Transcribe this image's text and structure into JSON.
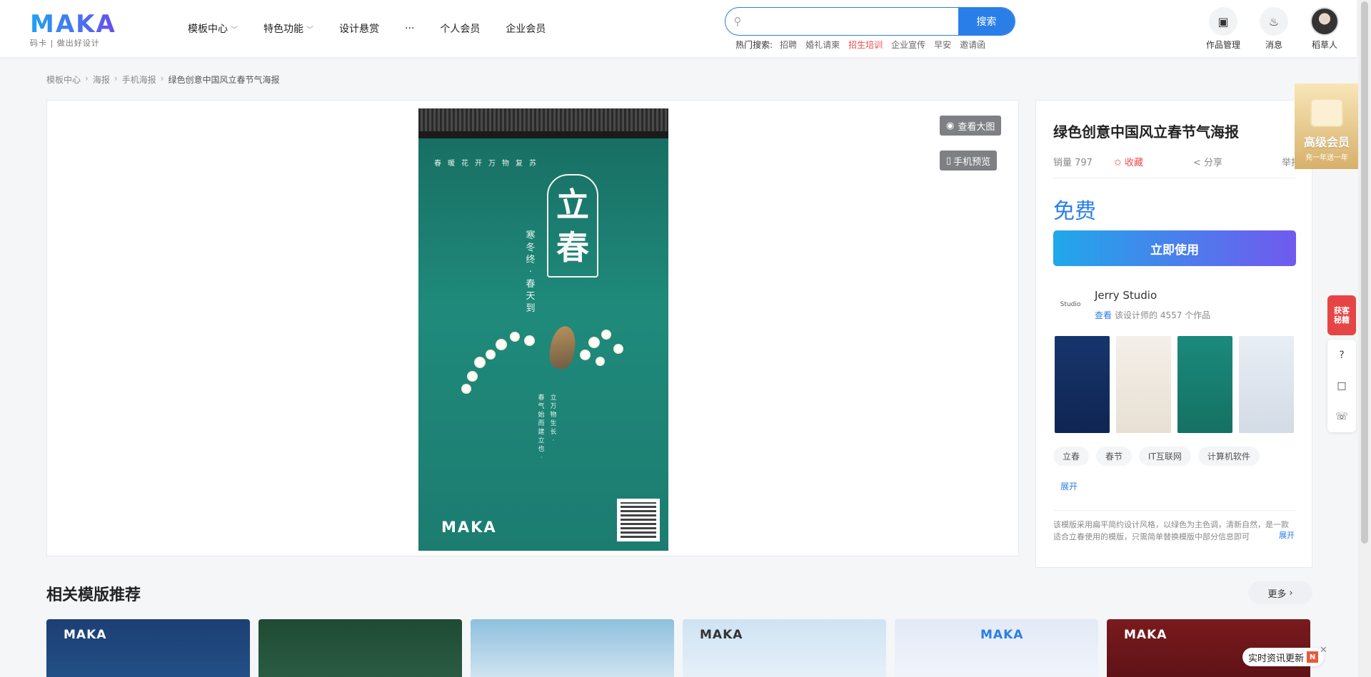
{
  "brand": {
    "logo": "MAKA",
    "tagline": "码卡 | 做出好设计",
    "accent": "#2a7ee8"
  },
  "nav": {
    "items": [
      {
        "label": "模板中心",
        "dropdown": true
      },
      {
        "label": "特色功能",
        "dropdown": true
      },
      {
        "label": "设计悬赏",
        "dropdown": false
      },
      {
        "label": "···",
        "dropdown": false
      },
      {
        "label": "个人会员",
        "dropdown": false
      },
      {
        "label": "企业会员",
        "dropdown": false
      }
    ]
  },
  "search": {
    "placeholder": "",
    "button": "搜索",
    "hot_label": "热门搜索:",
    "hot": [
      "招聘",
      "婚礼请柬",
      "招生培训",
      "企业宣传",
      "早安",
      "邀请函"
    ]
  },
  "top_right": {
    "works": "作品管理",
    "messages": "消息",
    "user": "稻草人"
  },
  "breadcrumb": [
    "模板中心",
    "海报",
    "手机海报",
    "绿色创意中国风立春节气海报"
  ],
  "preview": {
    "view_large": "查看大图",
    "mobile_preview": "手机预览",
    "poster": {
      "slogan": "春暖花开万物复苏",
      "big_1": "立",
      "big_2": "春",
      "vertical": "寒冬终 · 春天到",
      "vertical_2": "春气始而建立也 ·",
      "vertical_3": "立 万物生长 ·",
      "logo": "MAKA"
    }
  },
  "detail": {
    "title": "绿色创意中国风立春节气海报",
    "sales": "销量 797",
    "favorite": "✩ 收藏",
    "share": "分享",
    "report": "举报",
    "price": "免费",
    "use_button": "立即使用",
    "designer": {
      "name": "Jerry Studio",
      "view": "查看",
      "works_text": "该设计师的 4557 个作品",
      "avatar_text": "Studio"
    },
    "tags": [
      "立春",
      "春节",
      "IT互联网",
      "计算机软件"
    ],
    "expand": "展开",
    "description": "该模版采用扁平简约设计风格，以绿色为主色调，清新自然，是一款适合立春使用的模版，只需简单替换模版中部分信息即可",
    "desc_more": "展开"
  },
  "related": {
    "title": "相关模版推荐",
    "more": "更多"
  },
  "floating": {
    "vip_title": "高级会员",
    "vip_sub": "充一年送一年",
    "red_tag": "获客秘籍",
    "news": "实时资讯更新",
    "news_badge": "N",
    "close": "✕"
  },
  "rec_cards": [
    {
      "logo": "MAKA",
      "color": "#1c3f74"
    },
    {
      "logo": "",
      "color": "#1f4a33"
    },
    {
      "logo": "",
      "color": "#bcd7ea"
    },
    {
      "logo": "MAKA",
      "color": "#d8e8f5"
    },
    {
      "logo": "MAKA",
      "color": "#e8eef8"
    },
    {
      "logo": "MAKA",
      "color": "#7a1a1e"
    }
  ]
}
